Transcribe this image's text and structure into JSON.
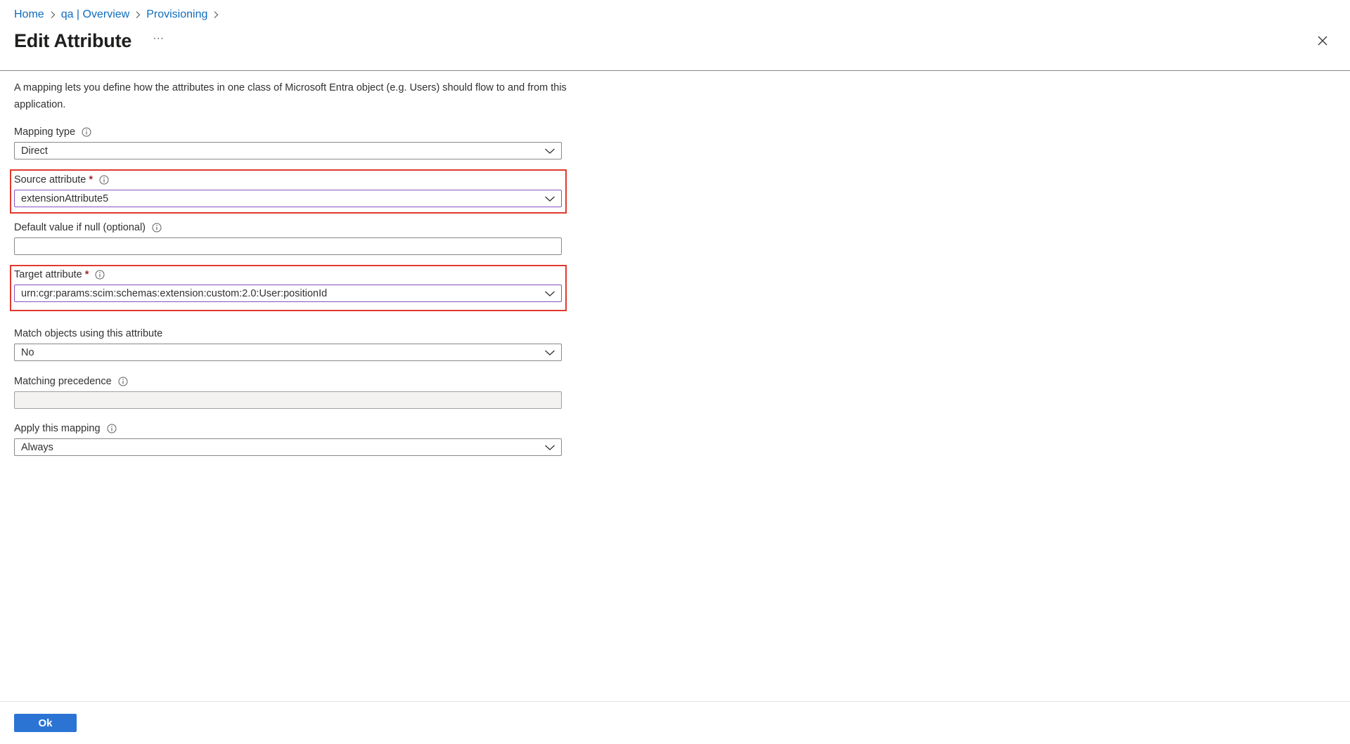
{
  "breadcrumb": {
    "items": [
      {
        "label": "Home"
      },
      {
        "label": "qa | Overview"
      },
      {
        "label": "Provisioning"
      }
    ],
    "separator_icon": "chevron-right-icon"
  },
  "header": {
    "title": "Edit Attribute",
    "more_label": "···",
    "close_icon": "close-icon"
  },
  "description": "A mapping lets you define how the attributes in one class of Microsoft Entra object (e.g. Users) should flow to and from this application.",
  "form": {
    "mapping_type": {
      "label": "Mapping type",
      "value": "Direct"
    },
    "source_attribute": {
      "label": "Source attribute",
      "required_mark": "*",
      "value": "extensionAttribute5"
    },
    "default_value": {
      "label": "Default value if null (optional)",
      "value": ""
    },
    "target_attribute": {
      "label": "Target attribute",
      "required_mark": "*",
      "value": "urn:cgr:params:scim:schemas:extension:custom:2.0:User:positionId"
    },
    "match_objects": {
      "label": "Match objects using this attribute",
      "value": "No"
    },
    "matching_precedence": {
      "label": "Matching precedence",
      "value": ""
    },
    "apply_mapping": {
      "label": "Apply this mapping",
      "value": "Always"
    }
  },
  "footer": {
    "ok_label": "Ok"
  },
  "colors": {
    "link": "#0f6cbd",
    "primary_button": "#2b74d4",
    "highlight": "#e03a2e",
    "required": "#a4262c",
    "focus_border": "#8a4fbf"
  }
}
